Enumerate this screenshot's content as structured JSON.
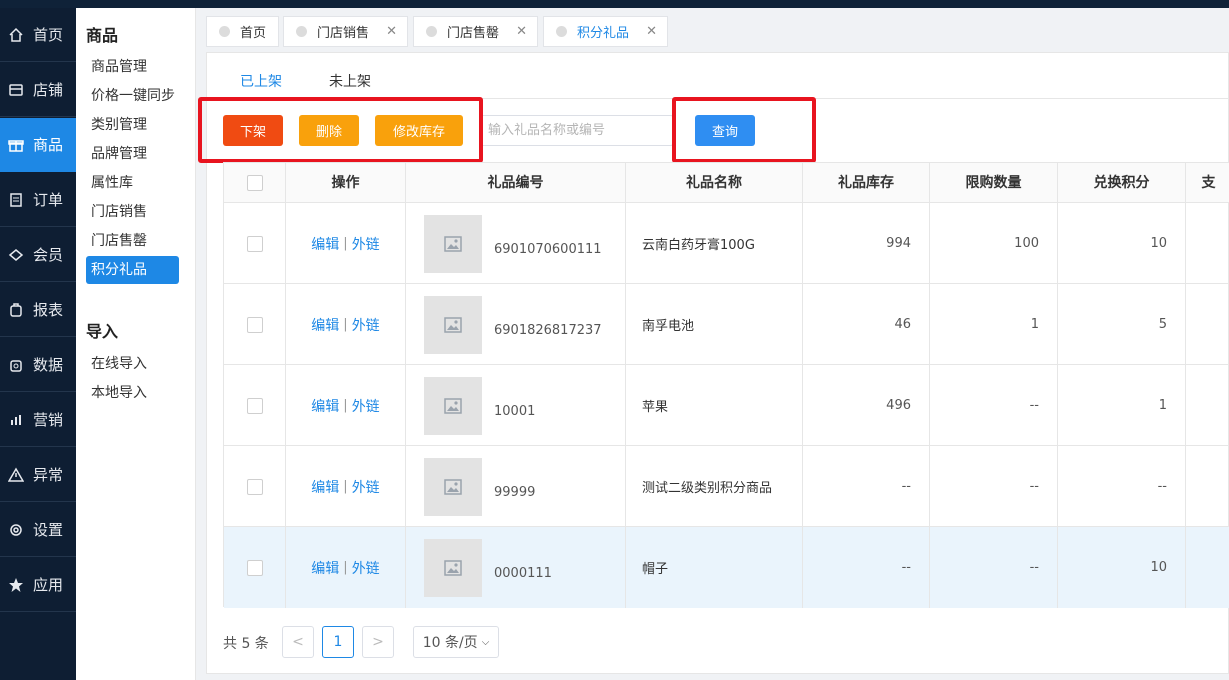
{
  "nav": {
    "items": [
      {
        "label": "首页",
        "icon": "home-icon"
      },
      {
        "label": "店铺",
        "icon": "store-icon"
      },
      {
        "label": "商品",
        "icon": "gift-icon",
        "active": true
      },
      {
        "label": "订单",
        "icon": "order-icon"
      },
      {
        "label": "会员",
        "icon": "member-icon"
      },
      {
        "label": "报表",
        "icon": "report-icon"
      },
      {
        "label": "数据",
        "icon": "data-icon"
      },
      {
        "label": "营销",
        "icon": "marketing-icon"
      },
      {
        "label": "异常",
        "icon": "warning-icon"
      },
      {
        "label": "设置",
        "icon": "gear-icon"
      },
      {
        "label": "应用",
        "icon": "star-icon"
      }
    ]
  },
  "submenu": {
    "title": "商品",
    "items": [
      "商品管理",
      "价格一键同步",
      "类别管理",
      "品牌管理",
      "属性库",
      "门店销售",
      "门店售罄",
      "积分礼品"
    ],
    "active": "积分礼品",
    "import_title": "导入",
    "import_items": [
      "在线导入",
      "本地导入"
    ]
  },
  "tabs": [
    {
      "label": "首页",
      "closable": false
    },
    {
      "label": "门店销售",
      "closable": true
    },
    {
      "label": "门店售罄",
      "closable": true
    },
    {
      "label": "积分礼品",
      "closable": true,
      "active": true
    }
  ],
  "panel": {
    "tabs": [
      "已上架",
      "未上架"
    ],
    "active_tab": "已上架",
    "buttons": {
      "offshelf": "下架",
      "delete": "删除",
      "edit_stock": "修改库存",
      "query": "查询"
    },
    "search_placeholder": "输入礼品名称或编号"
  },
  "table": {
    "headers": [
      "操作",
      "礼品编号",
      "礼品名称",
      "礼品库存",
      "限购数量",
      "兑换积分",
      "支"
    ],
    "op_edit": "编辑",
    "op_sep": "|",
    "op_link": "外链",
    "rows": [
      {
        "code": "6901070600111",
        "name": "云南白药牙膏100G",
        "stock": "994",
        "limit": "100",
        "points": "10"
      },
      {
        "code": "6901826817237",
        "name": "南孚电池",
        "stock": "46",
        "limit": "1",
        "points": "5"
      },
      {
        "code": "10001",
        "name": "苹果",
        "stock": "496",
        "limit": "--",
        "points": "1"
      },
      {
        "code": "99999",
        "name": "测试二级类别积分商品",
        "stock": "--",
        "limit": "--",
        "points": "--"
      },
      {
        "code": "0000111",
        "name": "帽子",
        "stock": "--",
        "limit": "--",
        "points": "10"
      }
    ]
  },
  "pagination": {
    "total": "共 5 条",
    "prev": "<",
    "current": "1",
    "next": ">",
    "page_size": "10 条/页"
  },
  "colors": {
    "accent": "#1e88e5",
    "danger": "#f04b12",
    "warning": "#f9a10c",
    "highlight": "#e8141f",
    "nav_bg": "#0e1e33"
  }
}
